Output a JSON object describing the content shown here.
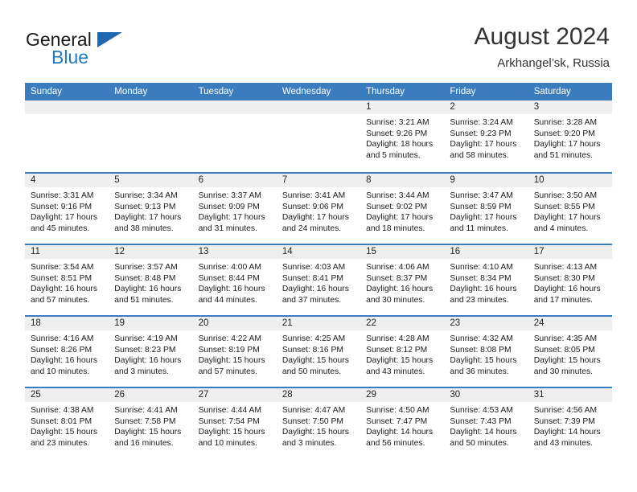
{
  "brand": {
    "name_part1": "General",
    "name_part2": "Blue",
    "flag_icon": "triangle-flag-icon",
    "accent_color": "#1f7bc4"
  },
  "header": {
    "title": "August 2024",
    "subtitle": "Arkhangel’sk, Russia"
  },
  "calendar": {
    "header_bg": "#3b7cbf",
    "daynum_bg": "#efefef",
    "weekdays": [
      "Sunday",
      "Monday",
      "Tuesday",
      "Wednesday",
      "Thursday",
      "Friday",
      "Saturday"
    ],
    "weeks": [
      [
        {
          "day": "",
          "lines": []
        },
        {
          "day": "",
          "lines": []
        },
        {
          "day": "",
          "lines": []
        },
        {
          "day": "",
          "lines": []
        },
        {
          "day": "1",
          "lines": [
            "Sunrise: 3:21 AM",
            "Sunset: 9:26 PM",
            "Daylight: 18 hours",
            "and 5 minutes."
          ]
        },
        {
          "day": "2",
          "lines": [
            "Sunrise: 3:24 AM",
            "Sunset: 9:23 PM",
            "Daylight: 17 hours",
            "and 58 minutes."
          ]
        },
        {
          "day": "3",
          "lines": [
            "Sunrise: 3:28 AM",
            "Sunset: 9:20 PM",
            "Daylight: 17 hours",
            "and 51 minutes."
          ]
        }
      ],
      [
        {
          "day": "4",
          "lines": [
            "Sunrise: 3:31 AM",
            "Sunset: 9:16 PM",
            "Daylight: 17 hours",
            "and 45 minutes."
          ]
        },
        {
          "day": "5",
          "lines": [
            "Sunrise: 3:34 AM",
            "Sunset: 9:13 PM",
            "Daylight: 17 hours",
            "and 38 minutes."
          ]
        },
        {
          "day": "6",
          "lines": [
            "Sunrise: 3:37 AM",
            "Sunset: 9:09 PM",
            "Daylight: 17 hours",
            "and 31 minutes."
          ]
        },
        {
          "day": "7",
          "lines": [
            "Sunrise: 3:41 AM",
            "Sunset: 9:06 PM",
            "Daylight: 17 hours",
            "and 24 minutes."
          ]
        },
        {
          "day": "8",
          "lines": [
            "Sunrise: 3:44 AM",
            "Sunset: 9:02 PM",
            "Daylight: 17 hours",
            "and 18 minutes."
          ]
        },
        {
          "day": "9",
          "lines": [
            "Sunrise: 3:47 AM",
            "Sunset: 8:59 PM",
            "Daylight: 17 hours",
            "and 11 minutes."
          ]
        },
        {
          "day": "10",
          "lines": [
            "Sunrise: 3:50 AM",
            "Sunset: 8:55 PM",
            "Daylight: 17 hours",
            "and 4 minutes."
          ]
        }
      ],
      [
        {
          "day": "11",
          "lines": [
            "Sunrise: 3:54 AM",
            "Sunset: 8:51 PM",
            "Daylight: 16 hours",
            "and 57 minutes."
          ]
        },
        {
          "day": "12",
          "lines": [
            "Sunrise: 3:57 AM",
            "Sunset: 8:48 PM",
            "Daylight: 16 hours",
            "and 51 minutes."
          ]
        },
        {
          "day": "13",
          "lines": [
            "Sunrise: 4:00 AM",
            "Sunset: 8:44 PM",
            "Daylight: 16 hours",
            "and 44 minutes."
          ]
        },
        {
          "day": "14",
          "lines": [
            "Sunrise: 4:03 AM",
            "Sunset: 8:41 PM",
            "Daylight: 16 hours",
            "and 37 minutes."
          ]
        },
        {
          "day": "15",
          "lines": [
            "Sunrise: 4:06 AM",
            "Sunset: 8:37 PM",
            "Daylight: 16 hours",
            "and 30 minutes."
          ]
        },
        {
          "day": "16",
          "lines": [
            "Sunrise: 4:10 AM",
            "Sunset: 8:34 PM",
            "Daylight: 16 hours",
            "and 23 minutes."
          ]
        },
        {
          "day": "17",
          "lines": [
            "Sunrise: 4:13 AM",
            "Sunset: 8:30 PM",
            "Daylight: 16 hours",
            "and 17 minutes."
          ]
        }
      ],
      [
        {
          "day": "18",
          "lines": [
            "Sunrise: 4:16 AM",
            "Sunset: 8:26 PM",
            "Daylight: 16 hours",
            "and 10 minutes."
          ]
        },
        {
          "day": "19",
          "lines": [
            "Sunrise: 4:19 AM",
            "Sunset: 8:23 PM",
            "Daylight: 16 hours",
            "and 3 minutes."
          ]
        },
        {
          "day": "20",
          "lines": [
            "Sunrise: 4:22 AM",
            "Sunset: 8:19 PM",
            "Daylight: 15 hours",
            "and 57 minutes."
          ]
        },
        {
          "day": "21",
          "lines": [
            "Sunrise: 4:25 AM",
            "Sunset: 8:16 PM",
            "Daylight: 15 hours",
            "and 50 minutes."
          ]
        },
        {
          "day": "22",
          "lines": [
            "Sunrise: 4:28 AM",
            "Sunset: 8:12 PM",
            "Daylight: 15 hours",
            "and 43 minutes."
          ]
        },
        {
          "day": "23",
          "lines": [
            "Sunrise: 4:32 AM",
            "Sunset: 8:08 PM",
            "Daylight: 15 hours",
            "and 36 minutes."
          ]
        },
        {
          "day": "24",
          "lines": [
            "Sunrise: 4:35 AM",
            "Sunset: 8:05 PM",
            "Daylight: 15 hours",
            "and 30 minutes."
          ]
        }
      ],
      [
        {
          "day": "25",
          "lines": [
            "Sunrise: 4:38 AM",
            "Sunset: 8:01 PM",
            "Daylight: 15 hours",
            "and 23 minutes."
          ]
        },
        {
          "day": "26",
          "lines": [
            "Sunrise: 4:41 AM",
            "Sunset: 7:58 PM",
            "Daylight: 15 hours",
            "and 16 minutes."
          ]
        },
        {
          "day": "27",
          "lines": [
            "Sunrise: 4:44 AM",
            "Sunset: 7:54 PM",
            "Daylight: 15 hours",
            "and 10 minutes."
          ]
        },
        {
          "day": "28",
          "lines": [
            "Sunrise: 4:47 AM",
            "Sunset: 7:50 PM",
            "Daylight: 15 hours",
            "and 3 minutes."
          ]
        },
        {
          "day": "29",
          "lines": [
            "Sunrise: 4:50 AM",
            "Sunset: 7:47 PM",
            "Daylight: 14 hours",
            "and 56 minutes."
          ]
        },
        {
          "day": "30",
          "lines": [
            "Sunrise: 4:53 AM",
            "Sunset: 7:43 PM",
            "Daylight: 14 hours",
            "and 50 minutes."
          ]
        },
        {
          "day": "31",
          "lines": [
            "Sunrise: 4:56 AM",
            "Sunset: 7:39 PM",
            "Daylight: 14 hours",
            "and 43 minutes."
          ]
        }
      ]
    ]
  }
}
